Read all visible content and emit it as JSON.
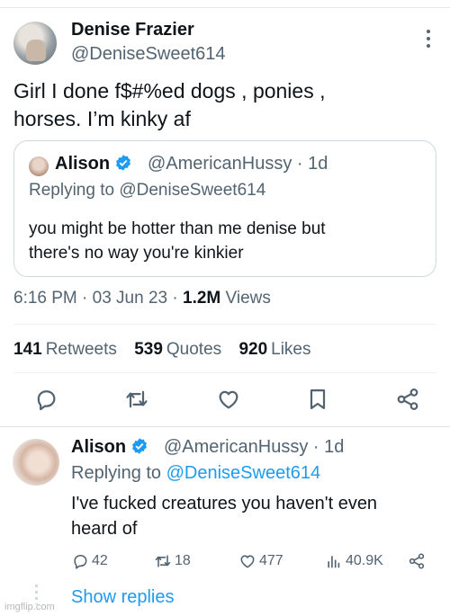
{
  "tweet": {
    "author_name": "Denise Frazier",
    "author_handle": "@DeniseSweet614",
    "text": "Girl I done f$#%ed dogs , ponies ,\nhorses. I’m kinky af",
    "time": "6:16 PM · 03 Jun 23 · ",
    "views_count": "1.2M",
    "views_label": " Views"
  },
  "quote": {
    "name": "Alison",
    "handle_time": "@AmericanHussy · 1d",
    "replying_to": "Replying to @DeniseSweet614",
    "text": "you might be hotter than me denise but\nthere's no way you're kinkier"
  },
  "stats": {
    "retweets_count": "141",
    "retweets_label": "Retweets",
    "quotes_count": "539",
    "quotes_label": "Quotes",
    "likes_count": "920",
    "likes_label": "Likes"
  },
  "reply": {
    "name": "Alison",
    "handle_time": "@AmericanHussy · 1d",
    "replying_prefix": "Replying to ",
    "replying_handle": "@DeniseSweet614",
    "text": "I've fucked creatures you haven't even\nheard of",
    "replies": "42",
    "retweets": "18",
    "likes": "477",
    "views": "40.9K",
    "show_replies": "Show replies"
  },
  "watermark": "imgflip.com",
  "colors": {
    "accent": "#1d9bf0",
    "muted": "#536471",
    "text": "#0f1419",
    "border": "#cfd9de"
  },
  "icons": [
    "more-icon",
    "verified-icon",
    "reply-icon",
    "retweet-icon",
    "like-icon",
    "bookmark-icon",
    "share-icon",
    "views-icon"
  ]
}
